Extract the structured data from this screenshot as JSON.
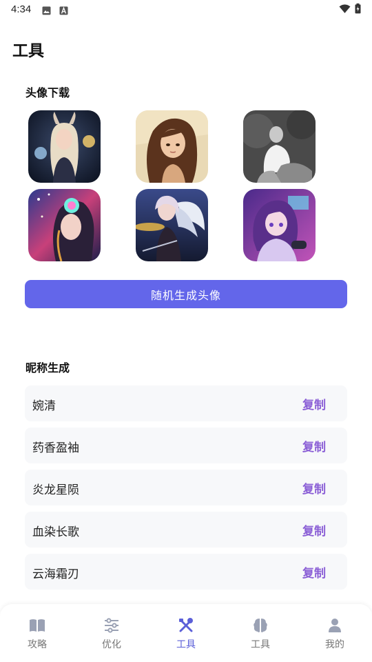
{
  "status_bar": {
    "time": "4:34",
    "icons": [
      "image-icon",
      "a-icon",
      "wifi-icon",
      "battery-icon"
    ]
  },
  "page": {
    "title": "工具"
  },
  "avatar_section": {
    "title": "头像下载",
    "avatars": [
      {
        "name": "avatar-1",
        "desc": "horned fantasy girl with orbs"
      },
      {
        "name": "avatar-2",
        "desc": "brown-haired girl"
      },
      {
        "name": "avatar-3",
        "desc": "black and white man"
      },
      {
        "name": "avatar-4",
        "desc": "girl with headphones"
      },
      {
        "name": "avatar-5",
        "desc": "winged drummer girl"
      },
      {
        "name": "avatar-6",
        "desc": "purple-haired gamer girl"
      }
    ],
    "button_label": "随机生成头像"
  },
  "nickname_section": {
    "title": "昵称生成",
    "copy_label": "复制",
    "items": [
      "婉清",
      "药香盈袖",
      "炎龙星陨",
      "血染长歌",
      "云海霜刃"
    ]
  },
  "tab_bar": {
    "tabs": [
      {
        "label": "攻略",
        "icon": "book-icon",
        "active": false
      },
      {
        "label": "优化",
        "icon": "sliders-icon",
        "active": false
      },
      {
        "label": "工具",
        "icon": "tools-icon",
        "active": true
      },
      {
        "label": "工具",
        "icon": "brain-icon",
        "active": false
      },
      {
        "label": "我的",
        "icon": "user-icon",
        "active": false
      }
    ]
  },
  "colors": {
    "accent": "#6366ea",
    "copy": "#8b5fd6",
    "active_tab": "#5b5fd8",
    "inactive_tab": "#9aa1b4",
    "row_bg": "#f7f8fa"
  }
}
